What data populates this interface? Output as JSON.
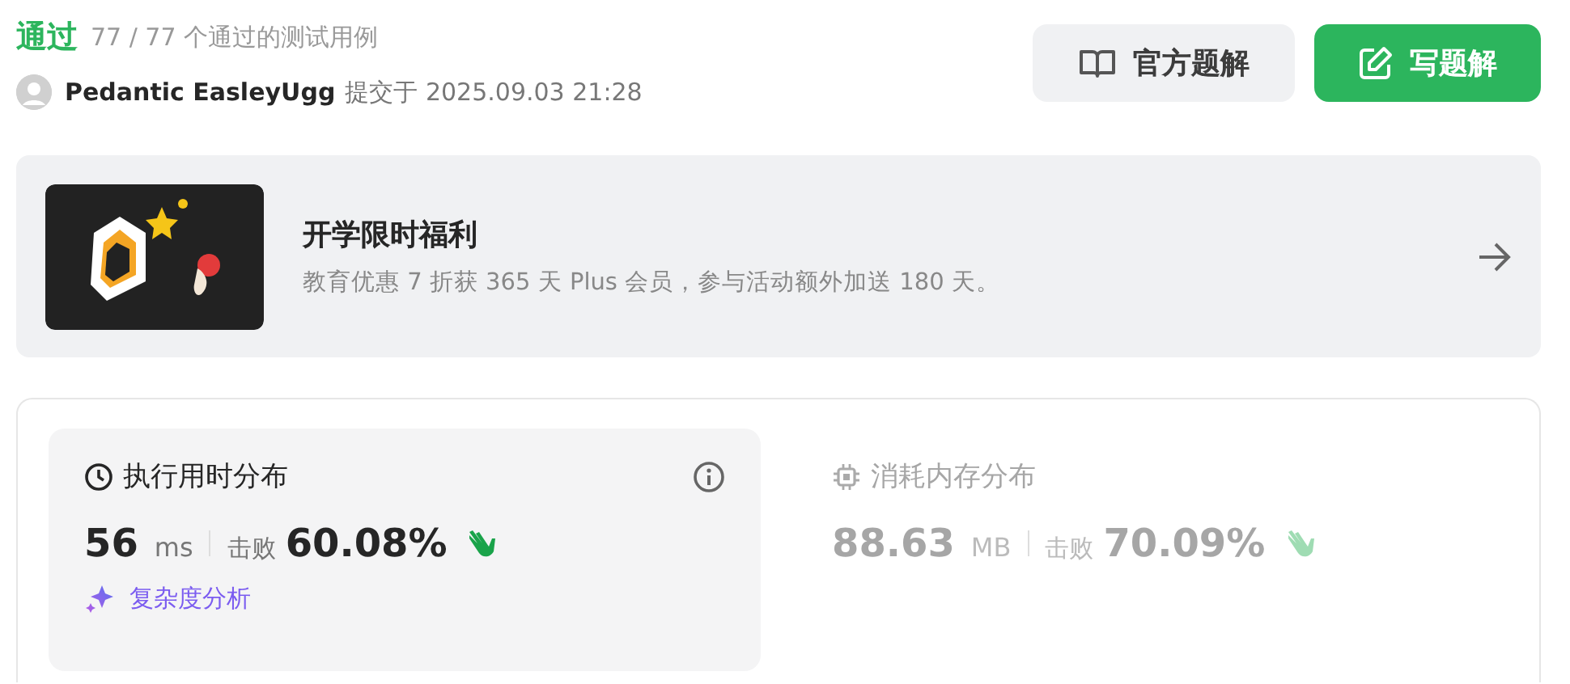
{
  "header": {
    "status": "通过",
    "cases": "77 / 77 个通过的测试用例",
    "user": "Pedantic EasleyUgg",
    "submitted": "提交于 2025.09.03 21:28"
  },
  "buttons": [
    {
      "kind": "secondary",
      "label": "官方题解"
    },
    {
      "kind": "primary",
      "label": "写题解"
    }
  ],
  "promo": {
    "title": "开学限时福利",
    "text": "教育优惠 7 折获 365 天 Plus 会员，参与活动额外加送 180 天。"
  },
  "stats": [
    {
      "kind": "time",
      "selected": true,
      "title": "执行用时分布",
      "value": "56",
      "unit": "ms",
      "beat_label": "击败",
      "beat": "60.08%",
      "analysis": "复杂度分析"
    },
    {
      "kind": "memory",
      "selected": false,
      "title": "消耗内存分布",
      "value": "88.63",
      "unit": "MB",
      "beat_label": "击败",
      "beat": "70.09%"
    }
  ]
}
